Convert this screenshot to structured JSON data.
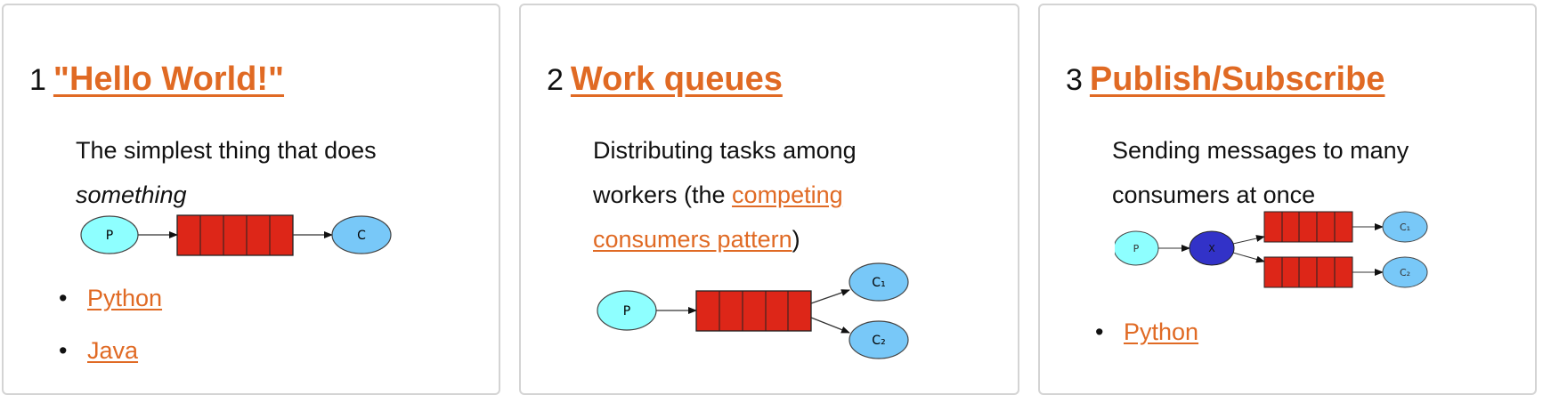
{
  "cards": [
    {
      "number": "1",
      "title": "\"Hello World!\"",
      "description": "The simplest thing that does",
      "description_em": "something",
      "diagram": {
        "producer": "P",
        "consumer": "C"
      },
      "links": [
        "Python",
        "Java"
      ]
    },
    {
      "number": "2",
      "title": "Work queues",
      "description_before": "Distributing tasks among workers (the ",
      "description_link": "competing consumers pattern",
      "description_after": ")",
      "diagram": {
        "producer": "P",
        "consumer1": "C₁",
        "consumer2": "C₂"
      }
    },
    {
      "number": "3",
      "title": "Publish/Subscribe",
      "description": "Sending messages to many consumers at once",
      "diagram": {
        "producer": "P",
        "exchange": "X",
        "consumer1": "C₁",
        "consumer2": "C₂"
      },
      "links": [
        "Python"
      ]
    }
  ],
  "colors": {
    "link": "#e06a24",
    "queue": "#dd2618",
    "producer": "#8effff",
    "consumer": "#78c8f8",
    "exchange": "#3232c8"
  }
}
